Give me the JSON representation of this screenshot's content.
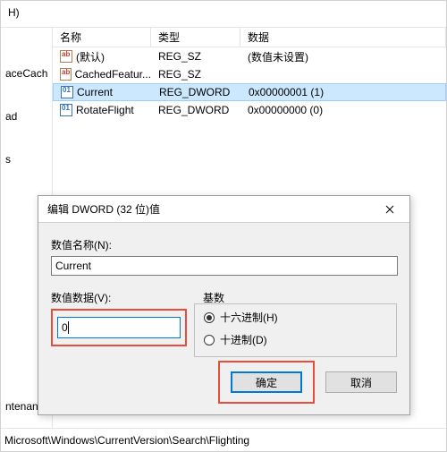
{
  "menu": {
    "item": "H)"
  },
  "tree": {
    "items": [
      "aceCach",
      "",
      "ad",
      "",
      "s",
      "",
      "",
      "",
      "",
      "",
      "",
      "",
      "ntenanc"
    ]
  },
  "list": {
    "headers": {
      "name": "名称",
      "type": "类型",
      "data": "数据"
    },
    "rows": [
      {
        "icon": "sz",
        "name": "(默认)",
        "type": "REG_SZ",
        "data": "(数值未设置)",
        "selected": false
      },
      {
        "icon": "sz",
        "name": "CachedFeatur...",
        "type": "REG_SZ",
        "data": "",
        "selected": false
      },
      {
        "icon": "dw",
        "name": "Current",
        "type": "REG_DWORD",
        "data": "0x00000001 (1)",
        "selected": true
      },
      {
        "icon": "dw",
        "name": "RotateFlight",
        "type": "REG_DWORD",
        "data": "0x00000000 (0)",
        "selected": false
      }
    ]
  },
  "dialog": {
    "title": "编辑 DWORD (32 位)值",
    "name_label": "数值名称(N):",
    "name_value": "Current",
    "value_label": "数值数据(V):",
    "value_data": "0",
    "radix_label": "基数",
    "hex_label": "十六进制(H)",
    "dec_label": "十进制(D)",
    "ok_label": "确定",
    "cancel_label": "取消"
  },
  "status": {
    "path": "Microsoft\\Windows\\CurrentVersion\\Search\\Flighting"
  }
}
